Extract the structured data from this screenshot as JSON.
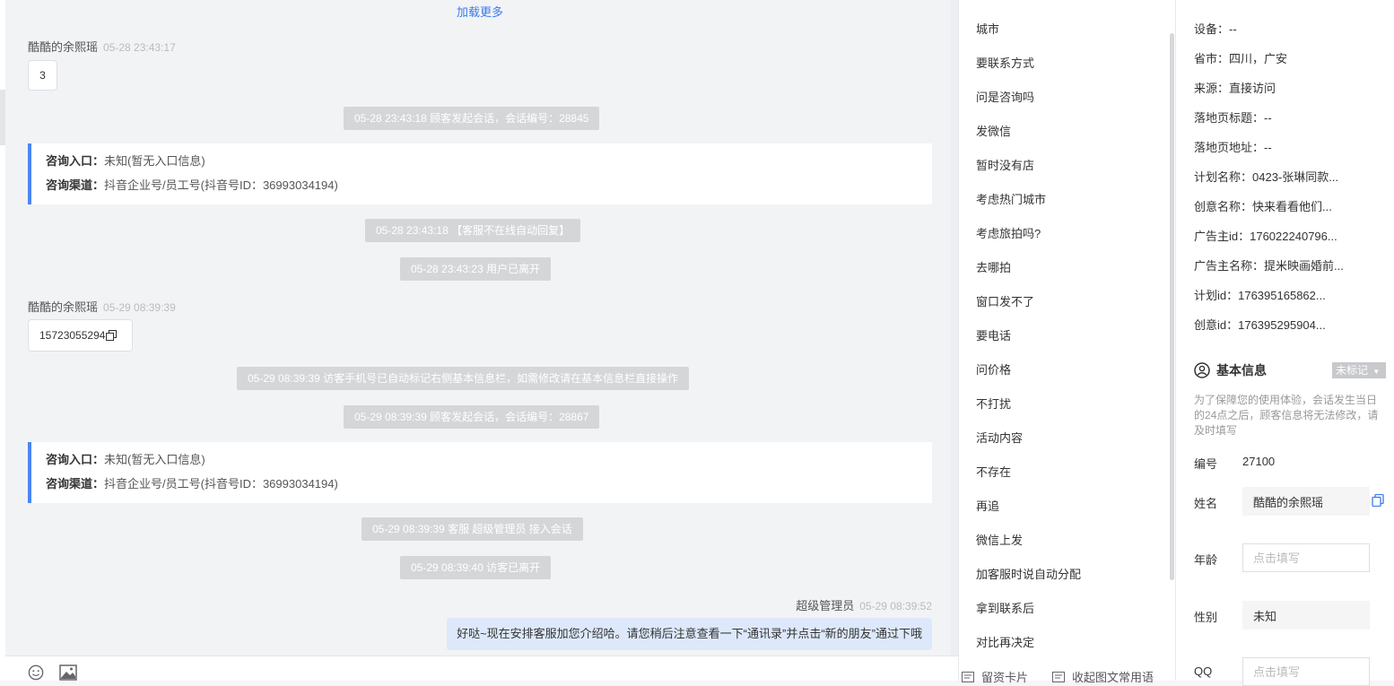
{
  "chat": {
    "load_more": "加载更多",
    "messages": [
      {
        "sender": "酷酷的余熙瑶",
        "time": "05-28 23:43:17",
        "content": "3"
      },
      {
        "sender": "酷酷的余熙瑶",
        "time": "05-29 08:39:39",
        "content": "15723055294"
      }
    ],
    "system": [
      "05-28 23:43:18 顾客发起会话，会话编号：28845",
      "05-28 23:43:18 【客服不在线自动回复】",
      "05-28 23:43:23 用户已离开",
      "05-29 08:39:39 访客手机号已自动标记右侧基本信息栏，如需修改请在基本信息栏直接操作",
      "05-29 08:39:39 顾客发起会话，会话编号：28867",
      "05-29 08:39:39 客服 超级管理员 接入会话",
      "05-29 08:39:40 访客已离开"
    ],
    "info_cards": [
      {
        "entry_label": "咨询入口：",
        "entry_value": "未知(暂无入口信息)",
        "channel_label": "咨询渠道：",
        "channel_value": "抖音企业号/员工号(抖音号ID：36993034194)"
      },
      {
        "entry_label": "咨询入口：",
        "entry_value": "未知(暂无入口信息)",
        "channel_label": "咨询渠道：",
        "channel_value": "抖音企业号/员工号(抖音号ID：36993034194)"
      }
    ],
    "agent": {
      "name": "超级管理员",
      "time": "05-29 08:39:52",
      "content": "好哒~现在安排客服加您介绍哈。请您稍后注意查看一下“通讯录”并点击“新的朋友”通过下哦"
    },
    "tools": {
      "emoji": "smile-icon",
      "image": "image-icon"
    }
  },
  "phrases": {
    "items": [
      "城市",
      "要联系方式",
      "问是咨询吗",
      "发微信",
      "暂时没有店",
      "考虑热门城市",
      "考虑旅拍吗?",
      "去哪拍",
      "窗口发不了",
      "要电话",
      "问价格",
      "不打扰",
      "活动内容",
      "不存在",
      "再追",
      "微信上发",
      "加客服时说自动分配",
      "拿到联系后",
      "对比再决定"
    ],
    "footer": {
      "card": "留资卡片",
      "collapse": "收起图文常用语"
    }
  },
  "info": {
    "source_fields": [
      "设备：--",
      "省市：四川，广安",
      "来源：直接访问",
      "落地页标题：--",
      "落地页地址：--",
      "计划名称：0423-张琳同款...",
      "创意名称：快来看看他们...",
      "广告主id：176022240796...",
      "广告主名称：提米映画婚前...",
      "计划id：176395165862...",
      "创意id：176395295904..."
    ],
    "basic": {
      "title": "基本信息",
      "badge": "未标记",
      "notice": "为了保障您的使用体验，会话发生当日的24点之后，顾客信息将无法修改，请及时填写",
      "id_label": "编号",
      "id_value": "27100",
      "name_label": "姓名",
      "name_value": "酷酷的余熙瑶",
      "age_label": "年龄",
      "age_placeholder": "点击填写",
      "gender_label": "性别",
      "gender_value": "未知",
      "qq_label": "QQ",
      "qq_placeholder": "点击填写"
    }
  }
}
